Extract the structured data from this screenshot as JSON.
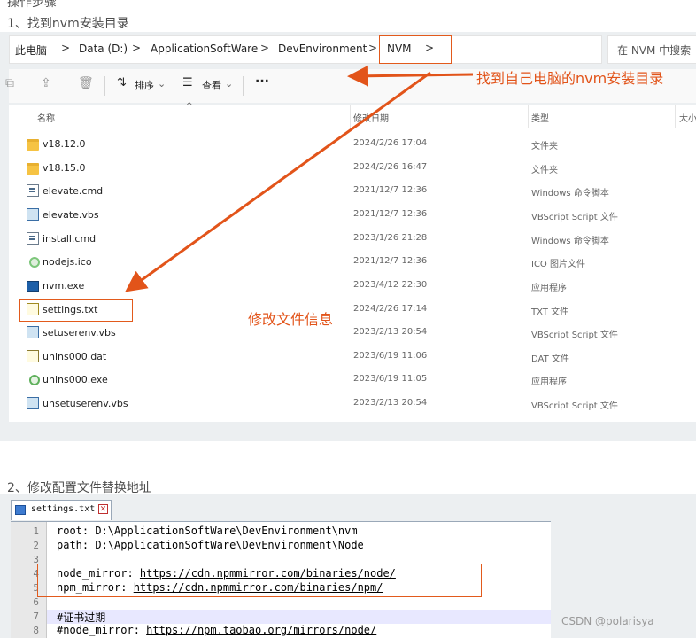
{
  "steps": {
    "step0_partial": "操作步骤",
    "step1": "1、找到nvm安装目录",
    "step2": "2、修改配置文件替换地址"
  },
  "explorer": {
    "breadcrumbs": [
      "此电脑",
      "Data (D:)",
      "ApplicationSoftWare",
      "DevEnvironment",
      "NVM"
    ],
    "separator": ">",
    "search_placeholder": "在 NVM 中搜索",
    "toolbar": {
      "sort_label": "排序",
      "view_label": "查看",
      "more_label": "···"
    },
    "columns": {
      "name": "名称",
      "date": "修改日期",
      "type": "类型",
      "size": "大小"
    },
    "files": [
      {
        "name": "v18.12.0",
        "date": "2024/2/26 17:04",
        "type": "文件夹",
        "icon": "folder-icon"
      },
      {
        "name": "v18.15.0",
        "date": "2024/2/26 16:47",
        "type": "文件夹",
        "icon": "folder-icon"
      },
      {
        "name": "elevate.cmd",
        "date": "2021/12/7 12:36",
        "type": "Windows 命令脚本",
        "icon": "cmd-file-icon"
      },
      {
        "name": "elevate.vbs",
        "date": "2021/12/7 12:36",
        "type": "VBScript Script 文件",
        "icon": "vbs-file-icon"
      },
      {
        "name": "install.cmd",
        "date": "2023/1/26 21:28",
        "type": "Windows 命令脚本",
        "icon": "cmd-file-icon"
      },
      {
        "name": "nodejs.ico",
        "date": "2021/12/7 12:36",
        "type": "ICO 图片文件",
        "icon": "ico-file-icon"
      },
      {
        "name": "nvm.exe",
        "date": "2023/4/12 22:30",
        "type": "应用程序",
        "icon": "exe-file-icon"
      },
      {
        "name": "settings.txt",
        "date": "2024/2/26 17:14",
        "type": "TXT 文件",
        "icon": "txt-file-icon"
      },
      {
        "name": "setuserenv.vbs",
        "date": "2023/2/13 20:54",
        "type": "VBScript Script 文件",
        "icon": "vbs-file-icon"
      },
      {
        "name": "unins000.dat",
        "date": "2023/6/19 11:06",
        "type": "DAT 文件",
        "icon": "dat-file-icon"
      },
      {
        "name": "unins000.exe",
        "date": "2023/6/19 11:05",
        "type": "应用程序",
        "icon": "setup-exe-icon"
      },
      {
        "name": "unsetuserenv.vbs",
        "date": "2023/2/13 20:54",
        "type": "VBScript Script 文件",
        "icon": "vbs-file-icon"
      }
    ]
  },
  "annotations": {
    "find_dir": "找到自己电脑的nvm安装目录",
    "edit_file": "修改文件信息",
    "color": "#e2541a"
  },
  "editor": {
    "tab_label": "settings.txt",
    "lines": [
      {
        "num": "1",
        "text": "root: D:\\ApplicationSoftWare\\DevEnvironment\\nvm"
      },
      {
        "num": "2",
        "text": "path: D:\\ApplicationSoftWare\\DevEnvironment\\Node"
      },
      {
        "num": "3",
        "text": ""
      },
      {
        "num": "4",
        "text_prefix": "node_mirror: ",
        "url": "https://cdn.npmmirror.com/binaries/node/"
      },
      {
        "num": "5",
        "text_prefix": "npm_mirror: ",
        "url": "https://cdn.npmmirror.com/binaries/npm/"
      },
      {
        "num": "6",
        "text": ""
      },
      {
        "num": "7",
        "text": "#证书过期"
      },
      {
        "num": "8",
        "text_prefix": "#node_mirror: ",
        "url": "https://npm.taobao.org/mirrors/node/"
      }
    ]
  },
  "watermark": "CSDN @polarisya"
}
